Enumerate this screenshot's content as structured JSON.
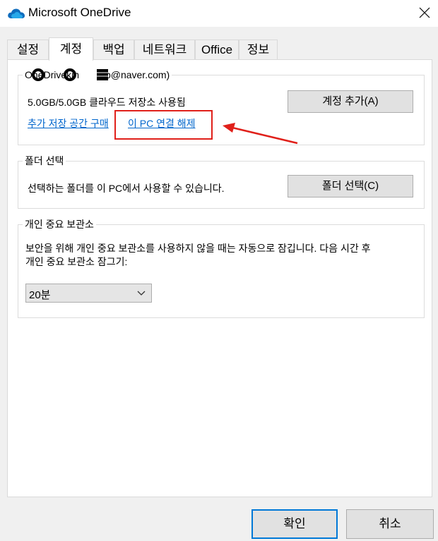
{
  "window": {
    "title": "Microsoft OneDrive"
  },
  "tabs": [
    "설정",
    "계정",
    "백업",
    "네트워크",
    "Office",
    "정보"
  ],
  "active_tab": "계정",
  "account": {
    "legend_prefix": "OneDrive",
    "legend_email_visible": "kin",
    "legend_email_tail": "jup@naver.com)",
    "storage_text": "5.0GB/5.0GB 클라우드 저장소 사용됨",
    "buy_storage_link": "추가 저장 공간 구매",
    "unlink_link": "이 PC 연결 해제",
    "add_account_button": "계정 추가(A)"
  },
  "folders": {
    "legend": "폴더 선택",
    "description": "선택하는 폴더를 이 PC에서 사용할 수 있습니다.",
    "choose_button": "폴더 선택(C)"
  },
  "vault": {
    "legend": "개인 중요 보관소",
    "description_line1": "보안을 위해 개인 중요 보관소를 사용하지 않을 때는 자동으로 잠깁니다. 다음 시간 후",
    "description_line2": "개인 중요 보관소 잠그기:",
    "lock_after_selected": "20분"
  },
  "footer": {
    "ok": "확인",
    "cancel": "취소"
  },
  "colors": {
    "link": "#0066cc",
    "annotation": "#e0201a",
    "primary_border": "#0078d7"
  },
  "icons": [
    "onedrive-cloud-icon",
    "close-icon",
    "chevron-down-icon",
    "annotation-arrow"
  ]
}
